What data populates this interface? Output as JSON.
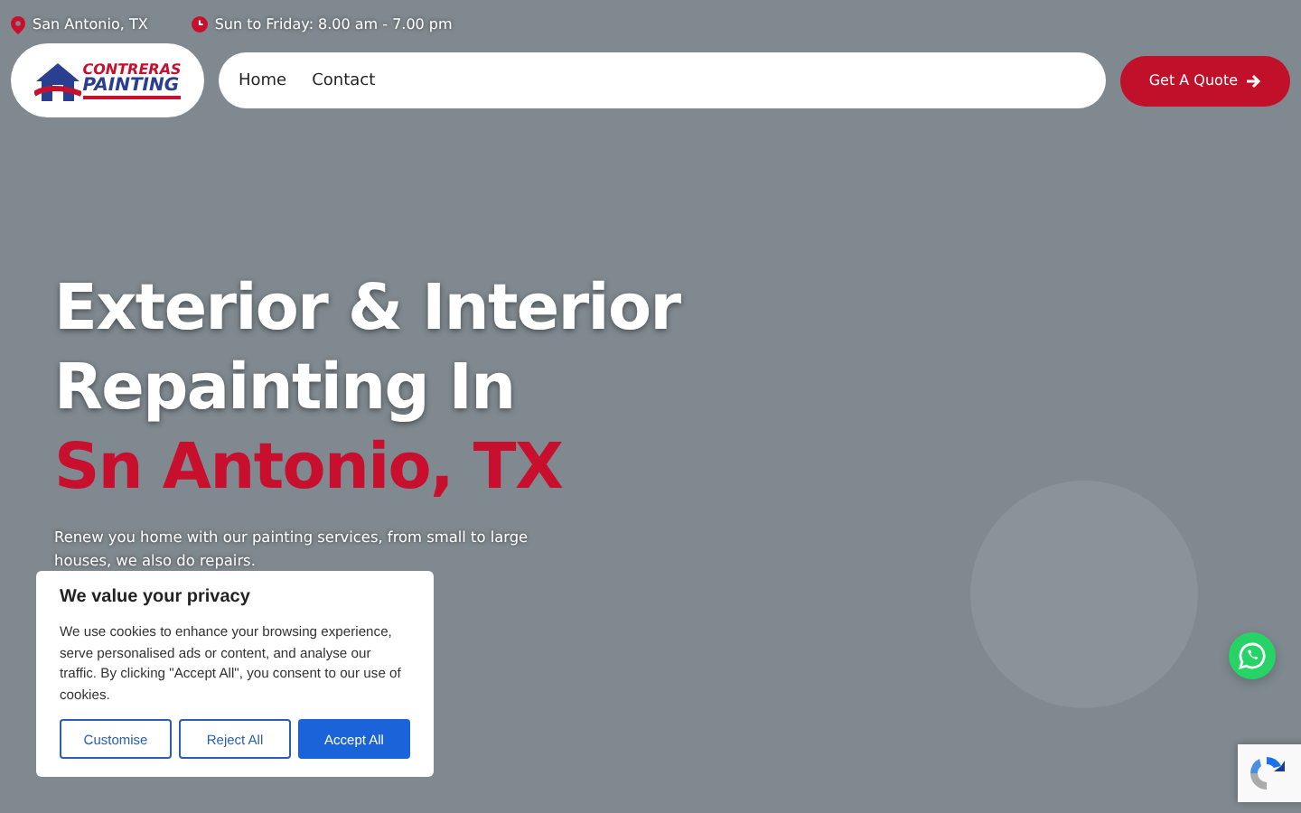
{
  "topbar": {
    "location": "San Antonio, TX",
    "hours": "Sun to Friday: 8.00 am - 7.00 pm"
  },
  "logo": {
    "line_1": "CONTRERAS",
    "line_2": "PAINTING"
  },
  "nav": [
    {
      "label": "Home"
    },
    {
      "label": "Contact"
    }
  ],
  "cta": {
    "label": "Get A Quote"
  },
  "hero": {
    "title_line_1": "Exterior & Interior",
    "title_line_2": "Repainting In",
    "title_accent": "Sn Antonio, TX",
    "text": "Renew you home with our painting services, from small to large houses, we also do repairs."
  },
  "cookie": {
    "title": "We value your privacy",
    "text": "We use cookies to enhance your browsing experience, serve personalised ads or content, and analyse our traffic. By clicking \"Accept All\", you consent to our use of cookies.",
    "buttons": [
      {
        "label": "Customise",
        "kind": "outline"
      },
      {
        "label": "Reject All",
        "kind": "outline"
      },
      {
        "label": "Accept All",
        "kind": "primary"
      }
    ]
  }
}
